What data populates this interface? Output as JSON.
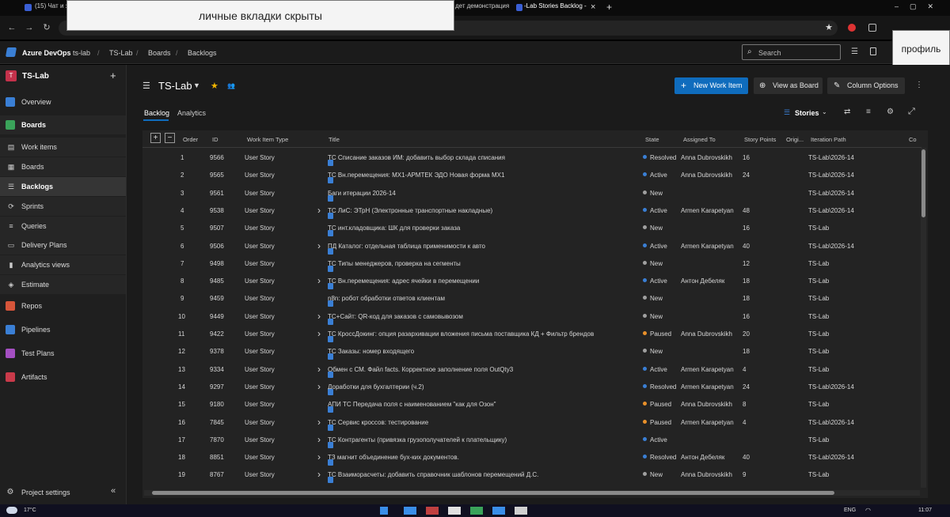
{
  "browser": {
    "tabs": [
      {
        "label": "(15) Чат и з"
      },
      {
        "label": "дет демонстрация"
      },
      {
        "label": "-Lab Stories Backlog - Boards"
      }
    ],
    "tab_close": "×",
    "new_tab": "+"
  },
  "overlays": {
    "hidden_tabs": "личные вкладки скрыты",
    "profile": "профиль"
  },
  "header": {
    "brand": "Azure DevOps",
    "breadcrumbs": [
      "ts-lab",
      "TS-Lab",
      "Boards",
      "Backlogs"
    ],
    "search_placeholder": "Search"
  },
  "sidebar": {
    "project_initial": "T",
    "project_name": "TS-Lab",
    "add": "+",
    "items": [
      {
        "label": "Overview",
        "icon": "overview-icon",
        "color": "#3a7fd5"
      },
      {
        "label": "Boards",
        "icon": "boards-icon",
        "color": "#3aa35a"
      },
      {
        "label": "Work items",
        "icon": "work-items-icon"
      },
      {
        "label": "Boards",
        "icon": "board-icon"
      },
      {
        "label": "Backlogs",
        "icon": "backlog-icon"
      },
      {
        "label": "Sprints",
        "icon": "sprint-icon"
      },
      {
        "label": "Queries",
        "icon": "query-icon"
      },
      {
        "label": "Delivery Plans",
        "icon": "delivery-icon"
      },
      {
        "label": "Analytics views",
        "icon": "analytics-icon"
      },
      {
        "label": "Estimate",
        "icon": "estimate-icon"
      },
      {
        "label": "Repos",
        "icon": "repos-icon",
        "color": "#d6553a"
      },
      {
        "label": "Pipelines",
        "icon": "pipelines-icon",
        "color": "#3a7fd5"
      },
      {
        "label": "Test Plans",
        "icon": "testplans-icon",
        "color": "#a44fc2"
      },
      {
        "label": "Artifacts",
        "icon": "artifacts-icon",
        "color": "#c93a4a"
      }
    ],
    "settings": "Project settings",
    "collapse": "«"
  },
  "main": {
    "board_title": "TS-Lab",
    "tabs": [
      "Backlog",
      "Analytics"
    ],
    "new_work_item": "New Work Item",
    "view_as_board": "View as Board",
    "column_options": "Column Options",
    "level": "Stories",
    "accent": "#0f6cbd"
  },
  "table": {
    "headers": [
      "Order",
      "ID",
      "Work Item Type",
      "Title",
      "State",
      "Assigned To",
      "Story Points",
      "Origi...",
      "Iteration Path",
      "Co"
    ],
    "rows": [
      {
        "order": "1",
        "id": "9566",
        "type": "User Story",
        "expand": false,
        "title": "ТС Списание заказов ИМ: добавить выбор склада списания",
        "state": "Resolved",
        "assigned": "Anna Dubrovskikh",
        "points": "16",
        "iteration": "TS-Lab\\2026-14"
      },
      {
        "order": "2",
        "id": "9565",
        "type": "User Story",
        "expand": false,
        "title": "ТС Вн.перемещения: МХ1-АРМТЕК ЭДО Новая форма МХ1",
        "state": "Active",
        "assigned": "Anna Dubrovskikh",
        "points": "24",
        "iteration": "TS-Lab\\2026-14"
      },
      {
        "order": "3",
        "id": "9561",
        "type": "User Story",
        "expand": false,
        "title": "Баги итерации 2026-14",
        "state": "New",
        "assigned": "",
        "points": "",
        "iteration": "TS-Lab\\2026-14"
      },
      {
        "order": "4",
        "id": "9538",
        "type": "User Story",
        "expand": true,
        "title": "ТС ЛиС: ЭТрН (Электронные транспортные накладные)",
        "state": "Active",
        "assigned": "Armen Karapetyan",
        "points": "48",
        "iteration": "TS-Lab\\2026-14"
      },
      {
        "order": "5",
        "id": "9507",
        "type": "User Story",
        "expand": false,
        "title": "ТС инт.кладовщика: ШК для проверки заказа",
        "state": "New",
        "assigned": "",
        "points": "16",
        "iteration": "TS-Lab"
      },
      {
        "order": "6",
        "id": "9506",
        "type": "User Story",
        "expand": true,
        "title": "ПД Каталог: отдельная таблица применимости к авто",
        "state": "Active",
        "assigned": "Armen Karapetyan",
        "points": "40",
        "iteration": "TS-Lab\\2026-14"
      },
      {
        "order": "7",
        "id": "9498",
        "type": "User Story",
        "expand": false,
        "title": "ТС Типы менеджеров, проверка на сегменты",
        "state": "New",
        "assigned": "",
        "points": "12",
        "iteration": "TS-Lab"
      },
      {
        "order": "8",
        "id": "9485",
        "type": "User Story",
        "expand": true,
        "title": "ТС Вн.перемещения: адрес ячейки в перемещении",
        "state": "Active",
        "assigned": "Антон Дебеляк",
        "points": "18",
        "iteration": "TS-Lab"
      },
      {
        "order": "9",
        "id": "9459",
        "type": "User Story",
        "expand": false,
        "title": "n8n: робот обработки ответов клиентам",
        "state": "New",
        "assigned": "",
        "points": "18",
        "iteration": "TS-Lab"
      },
      {
        "order": "10",
        "id": "9449",
        "type": "User Story",
        "expand": true,
        "title": "ТС+Сайт: QR-код для заказов с самовывозом",
        "state": "New",
        "assigned": "",
        "points": "16",
        "iteration": "TS-Lab"
      },
      {
        "order": "11",
        "id": "9422",
        "type": "User Story",
        "expand": true,
        "title": "ТС КроссДокинг: опция разархивации вложения письма поставщика КД + Фильтр брендов",
        "state": "Paused",
        "assigned": "Anna Dubrovskikh",
        "points": "20",
        "iteration": "TS-Lab"
      },
      {
        "order": "12",
        "id": "9378",
        "type": "User Story",
        "expand": false,
        "title": "ТС Заказы: номер входящего",
        "state": "New",
        "assigned": "",
        "points": "18",
        "iteration": "TS-Lab"
      },
      {
        "order": "13",
        "id": "9334",
        "type": "User Story",
        "expand": true,
        "title": "Обмен с СМ. Файл facts. Корректное заполнение поля OutQty3",
        "state": "Active",
        "assigned": "Armen Karapetyan",
        "points": "4",
        "iteration": "TS-Lab"
      },
      {
        "order": "14",
        "id": "9297",
        "type": "User Story",
        "expand": true,
        "title": "Доработки для бухгалтерии (ч.2)",
        "state": "Resolved",
        "assigned": "Armen Karapetyan",
        "points": "24",
        "iteration": "TS-Lab\\2026-14"
      },
      {
        "order": "15",
        "id": "9180",
        "type": "User Story",
        "expand": false,
        "title": "АПИ ТС Передача поля с наименованием \"как для Озон\"",
        "state": "Paused",
        "assigned": "Anna Dubrovskikh",
        "points": "8",
        "iteration": "TS-Lab"
      },
      {
        "order": "16",
        "id": "7845",
        "type": "User Story",
        "expand": true,
        "title": "ТС Сервис кроссов: тестирование",
        "state": "Paused",
        "assigned": "Armen Karapetyan",
        "points": "4",
        "iteration": "TS-Lab\\2026-14"
      },
      {
        "order": "17",
        "id": "7870",
        "type": "User Story",
        "expand": true,
        "title": "ТС Контрагенты (привязка грузополучателей к плательщику)",
        "state": "Active",
        "assigned": "",
        "points": "",
        "iteration": "TS-Lab"
      },
      {
        "order": "18",
        "id": "8851",
        "type": "User Story",
        "expand": true,
        "title": "ТЗ магнит объединение бух-ких документов.",
        "state": "Resolved",
        "assigned": "Антон Дебеляк",
        "points": "40",
        "iteration": "TS-Lab\\2026-14"
      },
      {
        "order": "19",
        "id": "8767",
        "type": "User Story",
        "expand": true,
        "title": "ТС Взаиморасчеты: добавить справочник шаблонов перемещений Д.С.",
        "state": "New",
        "assigned": "Anna Dubrovskikh",
        "points": "9",
        "iteration": "TS-Lab"
      }
    ]
  },
  "state_colors": {
    "Resolved": "#3a7fd5",
    "Active": "#3a7fd5",
    "New": "#a0a0a0",
    "Paused": "#e8902a"
  },
  "taskbar": {
    "weather": "17°C",
    "lang": "ENG",
    "time": "11:07"
  }
}
